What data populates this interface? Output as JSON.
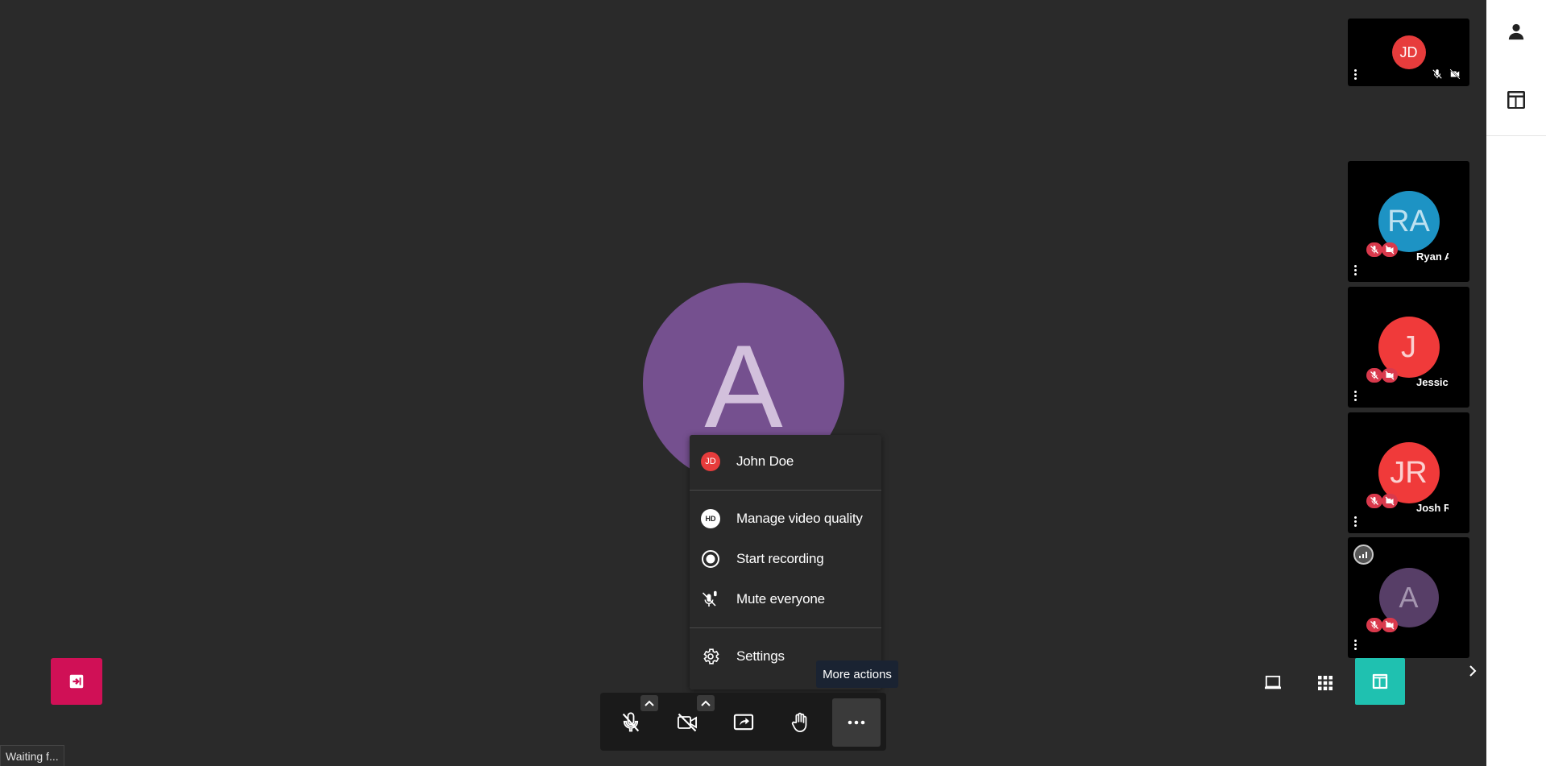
{
  "colors": {
    "background": "#2a2a2a",
    "accent_teal": "#1fc1b0",
    "leave_red": "#d01056",
    "mute_red": "#d9394c"
  },
  "main_avatar": {
    "initial": "A"
  },
  "thumbnails": [
    {
      "initials": "JD",
      "name": "",
      "avatar_color": "#e73c3c"
    },
    {
      "initials": "RA",
      "name": "Ryan A",
      "avatar_color": "#1d93c4"
    },
    {
      "initials": "J",
      "name": "Jessica",
      "avatar_color": "#f03a3a"
    },
    {
      "initials": "JR",
      "name": "Josh R",
      "avatar_color": "#f03a3a"
    },
    {
      "initials": "A",
      "name": "",
      "avatar_color": "#573e67"
    }
  ],
  "menu": {
    "user": {
      "initials": "JD",
      "label": "John Doe"
    },
    "video_quality": {
      "icon_text": "HD",
      "label": "Manage video quality"
    },
    "recording": {
      "label": "Start recording"
    },
    "mute_all": {
      "label": "Mute everyone"
    },
    "settings": {
      "label": "Settings"
    }
  },
  "tooltip": {
    "text": "More actions"
  },
  "status_bar": {
    "text": "Waiting f..."
  },
  "icons": {
    "right_rail": [
      "person-icon",
      "layout-icon"
    ],
    "toolbar": [
      "mic-off-icon",
      "camera-off-icon",
      "share-screen-icon",
      "raise-hand-icon",
      "more-icon"
    ],
    "view": [
      "whiteboard-icon",
      "grid-icon",
      "stage-layout-icon",
      "chevron-right-icon"
    ]
  }
}
